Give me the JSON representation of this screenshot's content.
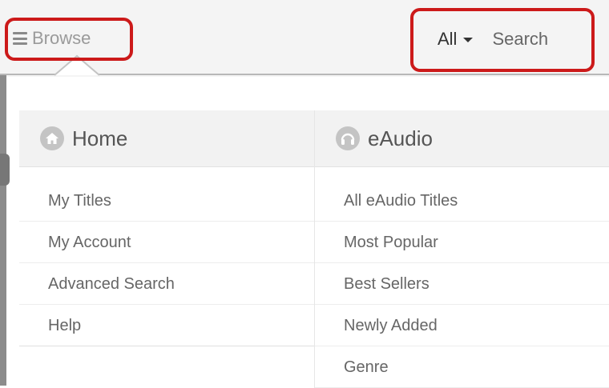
{
  "topbar": {
    "browse_label": "Browse",
    "scope_label": "All",
    "search_label": "Search"
  },
  "columns": [
    {
      "title": "Home",
      "icon": "house-icon",
      "items": [
        "My Titles",
        "My Account",
        "Advanced Search",
        "Help"
      ]
    },
    {
      "title": "eAudio",
      "icon": "headphones-icon",
      "items": [
        "All eAudio Titles",
        "Most Popular",
        "Best Sellers",
        "Newly Added",
        "Genre"
      ]
    }
  ],
  "colors": {
    "highlight": "#cc1a1a",
    "topbar_bg": "#f4f4f4",
    "header_bg": "#f2f2f2"
  }
}
